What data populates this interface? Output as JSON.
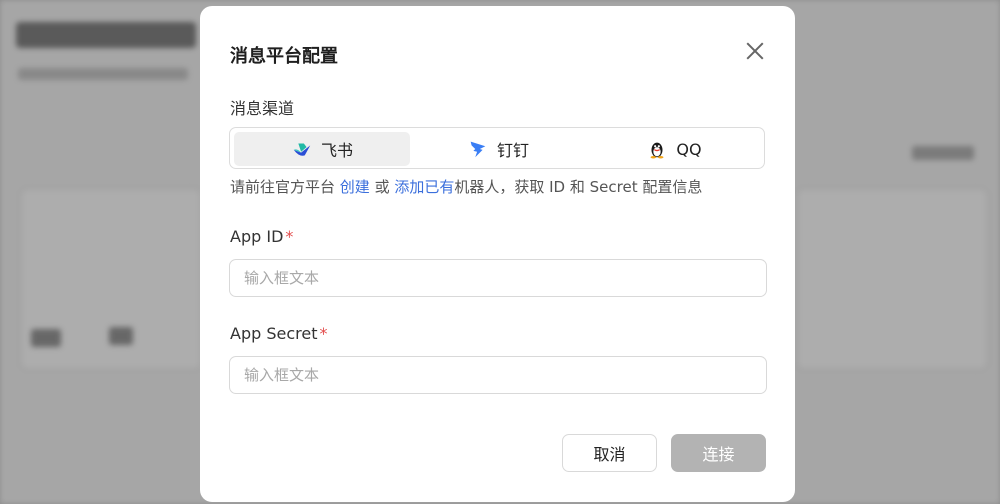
{
  "dialog": {
    "title": "消息平台配置",
    "channel_label": "消息渠道",
    "channels": [
      {
        "label": "飞书",
        "icon": "feishu-icon",
        "active": true
      },
      {
        "label": "钉钉",
        "icon": "dingtalk-icon",
        "active": false
      },
      {
        "label": "QQ",
        "icon": "qq-penguin-icon",
        "active": false
      }
    ],
    "hint": {
      "prefix": "请前往官方平台 ",
      "create_link": "创建",
      "or": " 或 ",
      "add_link": "添加已有",
      "suffix": "机器人，获取 ID 和 Secret 配置信息"
    },
    "app_id": {
      "label": "App ID",
      "required_mark": "*",
      "placeholder": "输入框文本",
      "value": ""
    },
    "app_secret": {
      "label": "App Secret",
      "required_mark": "*",
      "placeholder": "输入框文本",
      "value": ""
    },
    "cancel_label": "取消",
    "connect_label": "连接"
  },
  "colors": {
    "accent": "#3b6fdc",
    "required": "#e34d4d",
    "disabled_button": "#b3b3b3"
  }
}
